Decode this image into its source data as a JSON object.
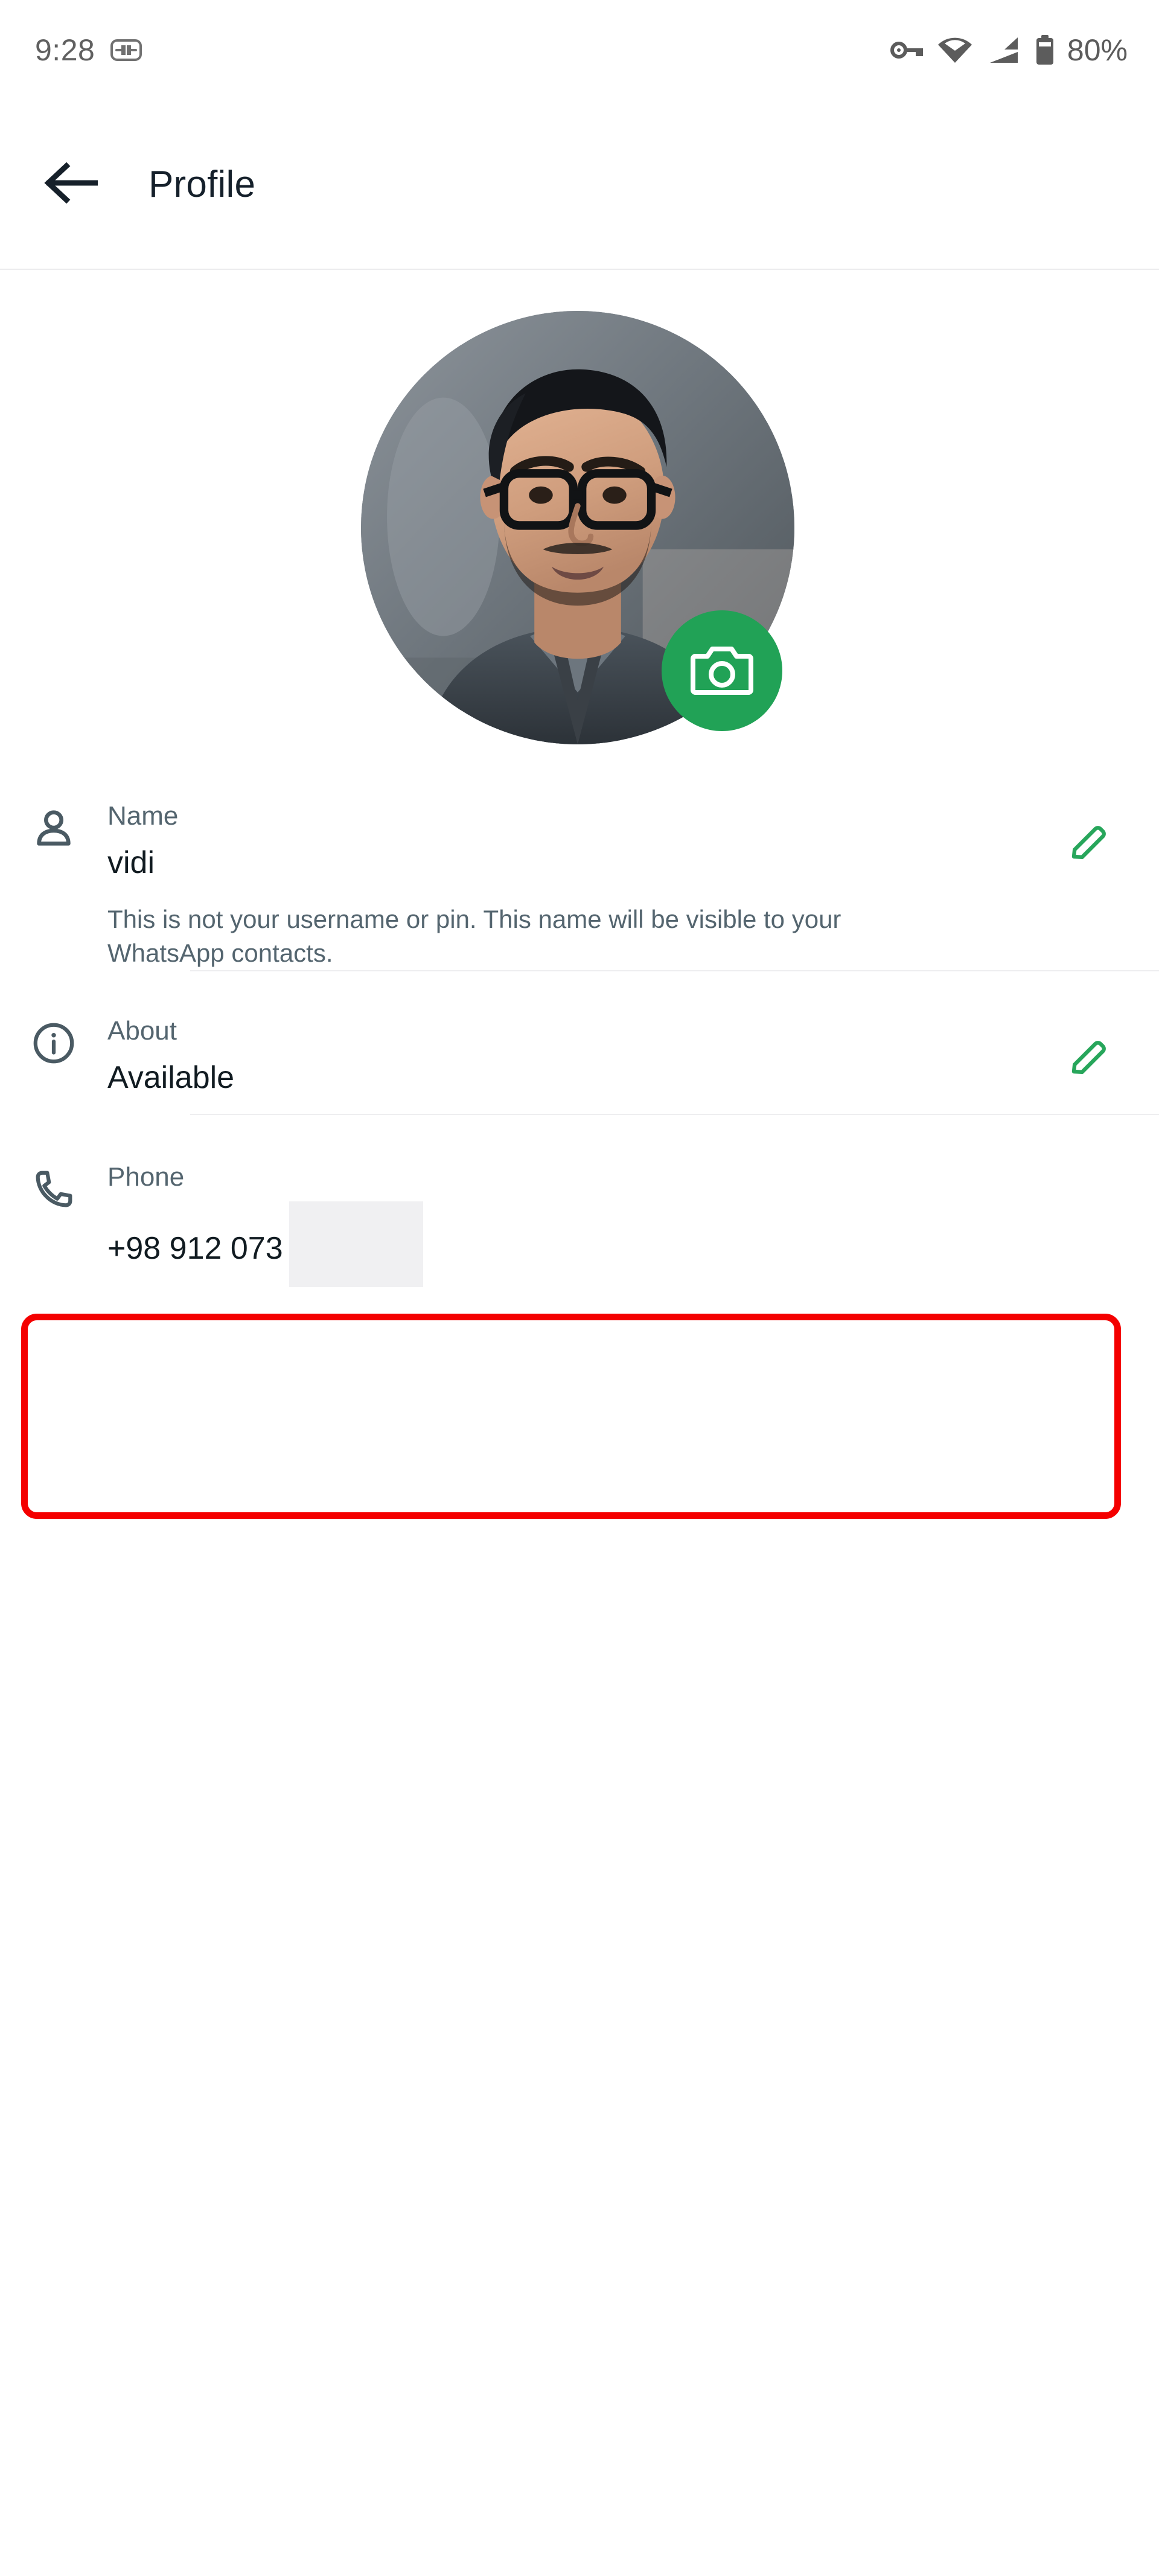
{
  "status_bar": {
    "clock": "9:28",
    "battery_percent": "80%",
    "icons": {
      "left": [
        "sim-card-icon"
      ],
      "right": [
        "vpn-key-icon",
        "wifi-icon",
        "cellular-signal-icon",
        "battery-icon"
      ]
    }
  },
  "app_bar": {
    "back_icon": "back-arrow-icon",
    "title": "Profile"
  },
  "avatar": {
    "alt": "profile-photo",
    "camera_icon": "camera-icon"
  },
  "rows": [
    {
      "id": "name",
      "icon": "person-icon",
      "label": "Name",
      "value": "vidi",
      "hint": "This is not your username or pin. This name will be visible to your WhatsApp contacts.",
      "edit_icon": "pencil-icon",
      "has_edit": true,
      "redacted": false,
      "highlighted": false
    },
    {
      "id": "about",
      "icon": "info-icon",
      "label": "About",
      "value": "Available",
      "hint": "",
      "edit_icon": "pencil-icon",
      "has_edit": true,
      "redacted": false,
      "highlighted": false
    },
    {
      "id": "phone",
      "icon": "phone-icon",
      "label": "Phone",
      "value": "+98 912 073",
      "hint": "",
      "edit_icon": "",
      "has_edit": false,
      "redacted": true,
      "highlighted": true
    }
  ],
  "colors": {
    "brand_green": "#21a256",
    "edit_green": "#27a65b",
    "label_gray": "#54656f",
    "value_dark": "#111b21",
    "divider": "#eeeef0",
    "highlight_red": "#f40000",
    "redaction_gray": "#f0f0f2"
  }
}
